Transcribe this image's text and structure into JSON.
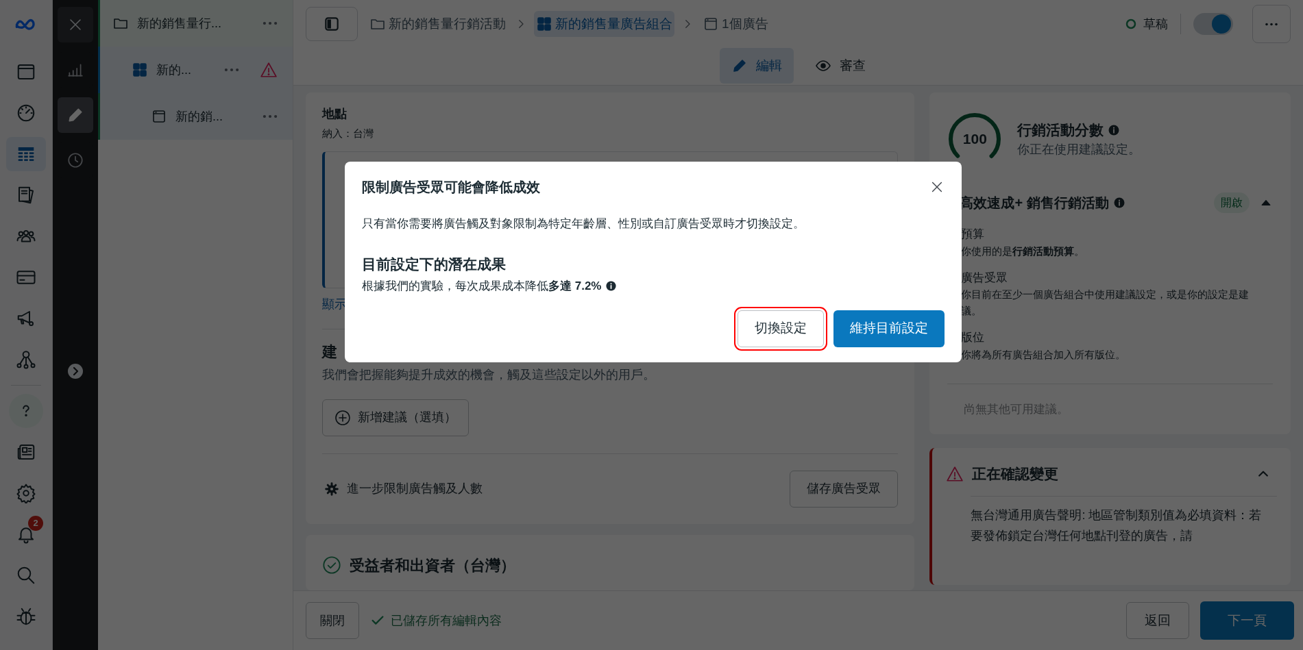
{
  "nav_rail": {
    "items": [
      {
        "selected": false
      },
      {
        "selected": false
      },
      {
        "selected": true
      },
      {
        "selected": false
      },
      {
        "selected": false
      },
      {
        "selected": false
      },
      {
        "selected": false
      },
      {
        "selected": false
      },
      {
        "selected": false
      },
      {
        "selected": false
      },
      {
        "selected": false
      },
      {
        "selected": false
      },
      {
        "selected": false
      },
      {
        "selected": false
      }
    ],
    "notification_count": "2"
  },
  "tool_rail": {
    "items": [
      {
        "selected": false
      },
      {
        "selected": true
      },
      {
        "selected": false
      }
    ]
  },
  "tree": [
    {
      "kind": "campaign",
      "label": "新的銷售量行...",
      "children": [
        {
          "kind": "adset",
          "label": "新的...",
          "warning": true,
          "children": [
            {
              "kind": "ad",
              "label": "新的銷...",
              "warning": false
            }
          ]
        }
      ]
    }
  ],
  "breadcrumb": [
    {
      "kind": "campaign",
      "label": "新的銷售量行銷活動",
      "selected": false
    },
    {
      "kind": "adset",
      "label": "新的銷售量廣告組合",
      "selected": true
    },
    {
      "kind": "ad",
      "label": "1個廣告",
      "selected": false
    }
  ],
  "status": {
    "label": "草稿"
  },
  "publish_toggle": {
    "on": true
  },
  "mode_tabs": [
    {
      "kind": "edit",
      "label": "編輯",
      "selected": true
    },
    {
      "kind": "review",
      "label": "審查",
      "selected": false
    }
  ],
  "audience_card": {
    "location_title": "地點",
    "location_detail": "納入：台灣",
    "show_link": "顯示",
    "suggestions_title": "建",
    "suggestions_desc": "我們會把握能夠提升成效的機會，觸及這些設定以外的用戶。",
    "add_button": "新增建議（選填）",
    "limit_link": "進一步限制廣告觸及人數",
    "save_button": "儲存廣告受眾"
  },
  "beneficiary_card": {
    "title": "受益者和出資者（台灣）",
    "complete": true
  },
  "score_card": {
    "score": "100",
    "title": "行銷活動分數",
    "subtitle": "你正在使用建議設定。"
  },
  "advantage": {
    "title": "高效速成+ 銷售行銷活動",
    "badge": "開啟",
    "expanded": true,
    "items": [
      {
        "title": "預算",
        "desc": "你使用的是**行銷活動預算**。"
      },
      {
        "title": "廣告受眾",
        "desc": "你目前在至少一個廣告組合中使用建議設定，或是你的設定是建議。"
      },
      {
        "title": "版位",
        "desc": "你將為所有廣告組合加入所有版位。"
      }
    ],
    "empty": "尚無其他可用建議。"
  },
  "review": {
    "title": "正在確認變更",
    "expanded": true,
    "text": "無台灣通用廣告聲明: 地區管制類別值為必填資料：若要發佈鎖定台灣任何地點刊登的廣告，請"
  },
  "footer": {
    "close": "關閉",
    "saved": "已儲存所有編輯內容",
    "back": "返回",
    "next": "下一頁"
  },
  "dialog": {
    "title": "限制廣告受眾可能會降低成效",
    "body": "只有當你需要將廣告觸及對象限制為特定年齡層、性別或自訂廣告受眾時才切換設定。",
    "subtitle": "目前設定下的潛在成果",
    "detail": "根據我們的實驗，每次成果成本降低**多達 7.2%**",
    "buttons": [
      {
        "kind": "secondary",
        "label": "切換設定",
        "highlighted": true
      },
      {
        "kind": "primary",
        "label": "維持目前設定",
        "highlighted": false
      }
    ]
  }
}
